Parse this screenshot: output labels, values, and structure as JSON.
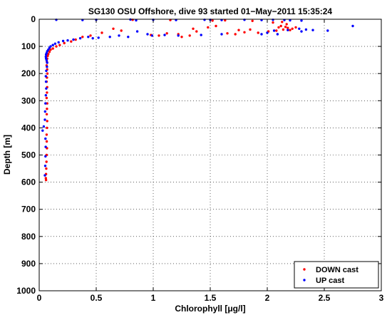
{
  "chart_data": {
    "type": "scatter",
    "title": "SG130 OSU Offshore, dive 93 started 01−May−2011 15:35:24",
    "xlabel": "Chlorophyll [μg/l]",
    "ylabel": "Depth [m]",
    "xlim": [
      0,
      3
    ],
    "ylim": [
      0,
      1000
    ],
    "y_reversed": true,
    "grid": true,
    "legend_position": "bottom-right",
    "x_ticks": [
      0,
      0.5,
      1,
      1.5,
      2,
      2.5,
      3
    ],
    "x_tick_labels": [
      "0",
      "0.5",
      "1",
      "1.5",
      "2",
      "2.5",
      "3"
    ],
    "y_ticks": [
      0,
      100,
      200,
      300,
      400,
      500,
      600,
      700,
      800,
      900,
      1000
    ],
    "y_tick_labels": [
      "0",
      "100",
      "200",
      "300",
      "400",
      "500",
      "600",
      "700",
      "800",
      "900",
      "1000"
    ],
    "series": [
      {
        "name": "DOWN cast",
        "color": "#ff0000",
        "marker": "dot",
        "points": [
          [
            0.82,
            2
          ],
          [
            1.15,
            3
          ],
          [
            1.52,
            5
          ],
          [
            1.63,
            4
          ],
          [
            1.87,
            6
          ],
          [
            2.05,
            12
          ],
          [
            2.13,
            10
          ],
          [
            2.17,
            18
          ],
          [
            2.12,
            25
          ],
          [
            2.16,
            28
          ],
          [
            2.18,
            32
          ],
          [
            2.1,
            30
          ],
          [
            2.22,
            35
          ],
          [
            2.14,
            38
          ],
          [
            2.2,
            40
          ],
          [
            2.08,
            42
          ],
          [
            2.25,
            30
          ],
          [
            2.01,
            45
          ],
          [
            1.75,
            40
          ],
          [
            1.85,
            38
          ],
          [
            1.92,
            50
          ],
          [
            1.8,
            48
          ],
          [
            1.65,
            52
          ],
          [
            1.72,
            55
          ],
          [
            1.55,
            25
          ],
          [
            1.48,
            30
          ],
          [
            1.35,
            35
          ],
          [
            1.38,
            45
          ],
          [
            1.32,
            60
          ],
          [
            1.22,
            55
          ],
          [
            1.12,
            52
          ],
          [
            1.25,
            65
          ],
          [
            1.05,
            60
          ],
          [
            0.98,
            58
          ],
          [
            0.65,
            35
          ],
          [
            0.72,
            42
          ],
          [
            0.55,
            50
          ],
          [
            0.45,
            60
          ],
          [
            0.38,
            65
          ],
          [
            0.32,
            75
          ],
          [
            0.28,
            82
          ],
          [
            0.22,
            88
          ],
          [
            0.18,
            95
          ],
          [
            0.15,
            100
          ],
          [
            0.12,
            108
          ],
          [
            0.1,
            112
          ],
          [
            0.09,
            120
          ],
          [
            0.08,
            128
          ],
          [
            0.075,
            135
          ],
          [
            0.07,
            145
          ],
          [
            0.068,
            158
          ],
          [
            0.065,
            170
          ],
          [
            0.07,
            185
          ],
          [
            0.072,
            200
          ],
          [
            0.068,
            215
          ],
          [
            0.065,
            230
          ],
          [
            0.07,
            250
          ],
          [
            0.068,
            270
          ],
          [
            0.065,
            290
          ],
          [
            0.07,
            310
          ],
          [
            0.068,
            330
          ],
          [
            0.066,
            350
          ],
          [
            0.07,
            375
          ],
          [
            0.068,
            400
          ],
          [
            0.065,
            425
          ],
          [
            0.066,
            450
          ],
          [
            0.068,
            475
          ],
          [
            0.065,
            500
          ],
          [
            0.064,
            525
          ],
          [
            0.062,
            550
          ],
          [
            0.06,
            570
          ],
          [
            0.058,
            585
          ],
          [
            0.06,
            592
          ]
        ]
      },
      {
        "name": "UP cast",
        "color": "#0000ff",
        "marker": "dot",
        "points": [
          [
            0.15,
            2
          ],
          [
            0.38,
            3
          ],
          [
            0.5,
            2
          ],
          [
            0.8,
            1
          ],
          [
            0.85,
            4
          ],
          [
            1.0,
            2
          ],
          [
            1.2,
            3
          ],
          [
            1.45,
            2
          ],
          [
            1.5,
            2
          ],
          [
            1.6,
            3
          ],
          [
            1.8,
            2
          ],
          [
            1.95,
            3
          ],
          [
            2.05,
            2
          ],
          [
            2.15,
            3
          ],
          [
            2.2,
            4
          ],
          [
            2.3,
            5
          ],
          [
            2.75,
            25
          ],
          [
            2.53,
            42
          ],
          [
            2.34,
            38
          ],
          [
            2.28,
            35
          ],
          [
            2.4,
            40
          ],
          [
            2.3,
            45
          ],
          [
            2.18,
            40
          ],
          [
            2.06,
            42
          ],
          [
            2.09,
            55
          ],
          [
            2.0,
            50
          ],
          [
            1.95,
            55
          ],
          [
            1.6,
            55
          ],
          [
            1.42,
            58
          ],
          [
            1.22,
            60
          ],
          [
            1.1,
            58
          ],
          [
            0.99,
            60
          ],
          [
            0.95,
            55
          ],
          [
            0.86,
            45
          ],
          [
            0.78,
            65
          ],
          [
            0.7,
            60
          ],
          [
            0.62,
            65
          ],
          [
            0.52,
            68
          ],
          [
            0.47,
            70
          ],
          [
            0.43,
            65
          ],
          [
            0.36,
            70
          ],
          [
            0.3,
            75
          ],
          [
            0.25,
            78
          ],
          [
            0.21,
            80
          ],
          [
            0.17,
            85
          ],
          [
            0.14,
            90
          ],
          [
            0.12,
            95
          ],
          [
            0.1,
            100
          ],
          [
            0.09,
            105
          ],
          [
            0.08,
            112
          ],
          [
            0.07,
            118
          ],
          [
            0.065,
            125
          ],
          [
            0.06,
            130
          ],
          [
            0.058,
            138
          ],
          [
            0.06,
            145
          ],
          [
            0.065,
            152
          ],
          [
            0.07,
            160
          ],
          [
            0.068,
            175
          ],
          [
            0.062,
            190
          ],
          [
            0.058,
            210
          ],
          [
            0.06,
            230
          ],
          [
            0.062,
            255
          ],
          [
            0.058,
            280
          ],
          [
            0.055,
            310
          ],
          [
            0.052,
            340
          ],
          [
            0.05,
            370
          ],
          [
            0.04,
            395
          ],
          [
            0.03,
            410
          ],
          [
            0.055,
            440
          ],
          [
            0.057,
            470
          ],
          [
            0.055,
            505
          ],
          [
            0.053,
            540
          ],
          [
            0.05,
            575
          ]
        ]
      }
    ]
  }
}
